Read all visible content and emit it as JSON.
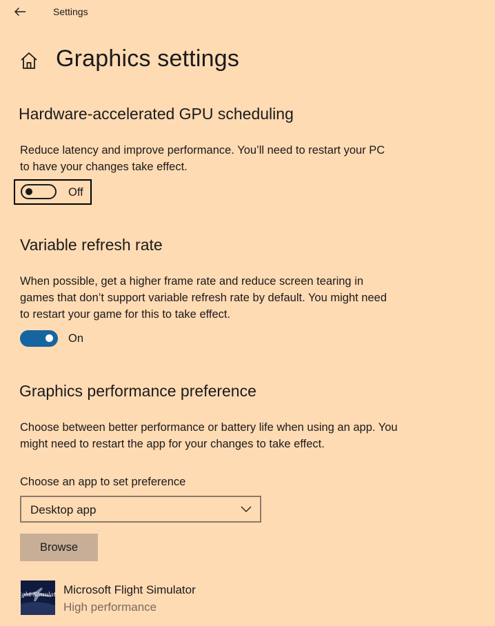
{
  "window": {
    "title": "Settings"
  },
  "page": {
    "title": "Graphics settings"
  },
  "gpu_scheduling": {
    "title": "Hardware-accelerated GPU scheduling",
    "description": "Reduce latency and improve performance. You’ll need to restart your PC to have your changes take effect.",
    "toggle_label": "Off",
    "state": "off"
  },
  "vrr": {
    "title": "Variable refresh rate",
    "description": "When possible, get a higher frame rate and reduce screen tearing in games that don’t support variable refresh rate by default. You might need to restart your game for this to take effect.",
    "toggle_label": "On",
    "state": "on"
  },
  "perf_pref": {
    "title": "Graphics performance preference",
    "description": "Choose between better performance or battery life when using an app. You might need to restart the app for your changes to take effect.",
    "choose_label": "Choose an app to set preference",
    "dropdown_value": "Desktop app",
    "browse_label": "Browse"
  },
  "apps": [
    {
      "name": "Microsoft Flight Simulator",
      "preference": "High performance",
      "icon_text": "Flight Simulator"
    }
  ],
  "colors": {
    "background": "#FFDBB4",
    "accent": "#1565A0",
    "button": "#C9AE97"
  }
}
